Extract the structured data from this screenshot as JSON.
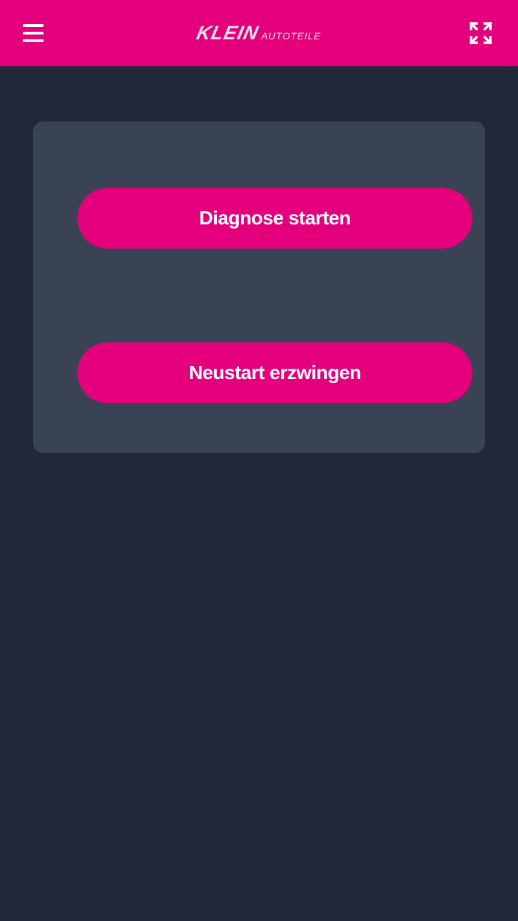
{
  "header": {
    "logo_main": "KLEIN",
    "logo_sub": "AUTOTEILE",
    "menu_icon": "hamburger-menu-icon",
    "fullscreen_icon": "fullscreen-expand-icon"
  },
  "panel": {
    "diagnose_label": "Diagnose starten",
    "restart_label": "Neustart erzwingen"
  },
  "colors": {
    "brand": "#e4007c",
    "background": "#212938",
    "panel": "#3a4354",
    "logo_text": "#e8e3e8"
  }
}
